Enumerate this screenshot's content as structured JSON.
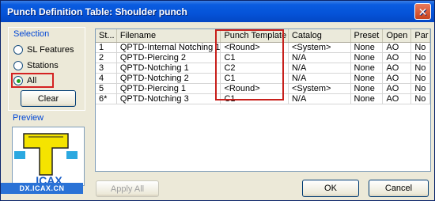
{
  "window": {
    "title": "Punch Definition Table: Shoulder punch",
    "close_glyph": "✕"
  },
  "selection": {
    "title": "Selection",
    "options": [
      {
        "label": "SL Features",
        "checked": false
      },
      {
        "label": "Stations",
        "checked": false
      },
      {
        "label": "All",
        "checked": true
      }
    ],
    "clear_label": "Clear"
  },
  "preview": {
    "title": "Preview",
    "watermark": "DX.ICAX.CN",
    "logo_text": "ICAX"
  },
  "buttons": {
    "apply_all": "Apply All",
    "ok": "OK",
    "cancel": "Cancel"
  },
  "table": {
    "columns": [
      "St...",
      "Filename",
      "Punch Template",
      "Catalog",
      "Preset",
      "Open",
      "Par"
    ],
    "rows": [
      [
        "1",
        "QPTD-Internal Notching 1",
        "<Round>",
        "<System>",
        "None",
        "AO",
        "No"
      ],
      [
        "2",
        "QPTD-Piercing 2",
        "C1",
        "N/A",
        "None",
        "AO",
        "No"
      ],
      [
        "3",
        "QPTD-Notching 1",
        "C2",
        "N/A",
        "None",
        "AO",
        "No"
      ],
      [
        "4",
        "QPTD-Notching 2",
        "C1",
        "N/A",
        "None",
        "AO",
        "No"
      ],
      [
        "5",
        "QPTD-Piercing 1",
        "<Round>",
        "<System>",
        "None",
        "AO",
        "No"
      ],
      [
        "6*",
        "QPTD-Notching 3",
        "C1",
        "N/A",
        "None",
        "AO",
        "No"
      ]
    ]
  },
  "colors": {
    "title_bar": "#0553d8",
    "highlight": "#c8201c",
    "group_title": "#0046d5"
  }
}
